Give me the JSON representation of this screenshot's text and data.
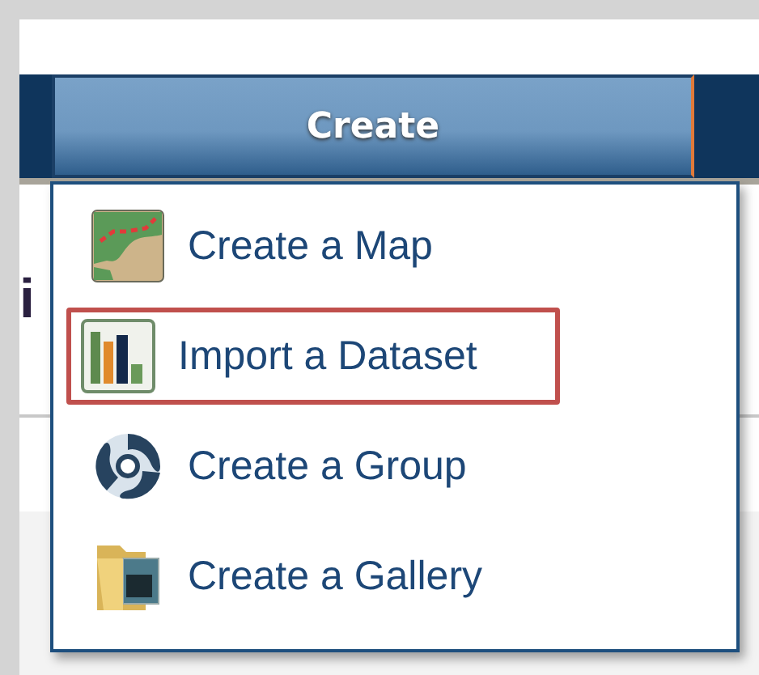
{
  "nav": {
    "button": "Create"
  },
  "heading_fragment": "i",
  "menu": [
    {
      "kind": "map",
      "label": "Create a Map",
      "selected": false
    },
    {
      "kind": "dataset",
      "label": "Import a Dataset",
      "selected": true
    },
    {
      "kind": "group",
      "label": "Create a Group",
      "selected": false
    },
    {
      "kind": "gallery",
      "label": "Create a Gallery",
      "selected": false
    }
  ]
}
